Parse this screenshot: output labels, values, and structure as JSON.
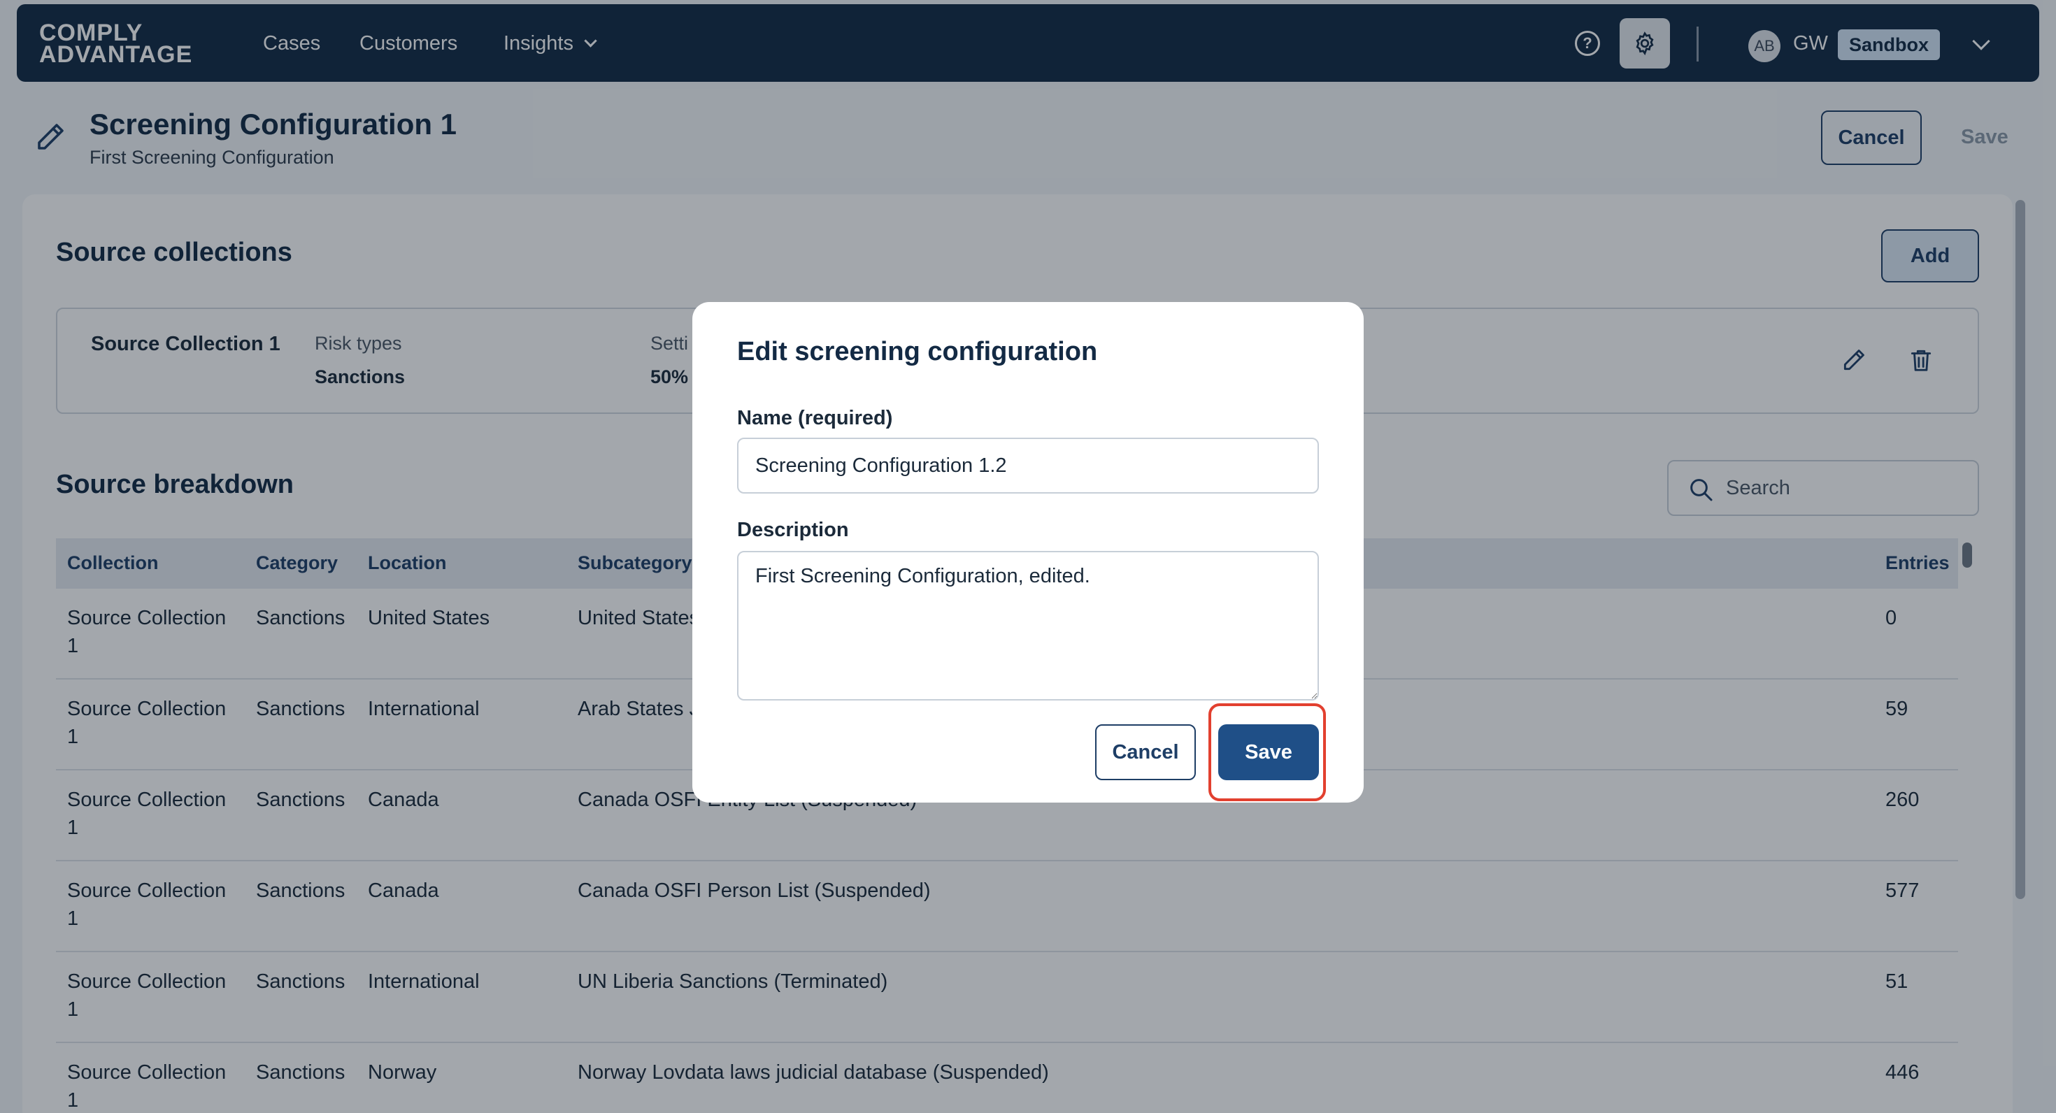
{
  "nav": {
    "logo_line1": "COMPLY",
    "logo_line2": "ADVANTAGE",
    "links": [
      "Cases",
      "Customers",
      "Insights"
    ],
    "help_glyph": "?",
    "avatar_initials": "AB",
    "user_initials": "GW",
    "environment": "Sandbox"
  },
  "header": {
    "title": "Screening Configuration 1",
    "subtitle": "First Screening Configuration",
    "cancel_label": "Cancel",
    "save_label": "Save"
  },
  "source_collections": {
    "title": "Source collections",
    "add_label": "Add",
    "item": {
      "name": "Source Collection 1",
      "risk_label": "Risk types",
      "risk_value": "Sanctions",
      "settings_label": "Setti",
      "settings_value": "50%"
    }
  },
  "source_breakdown": {
    "title": "Source breakdown",
    "search_placeholder": "Search",
    "columns": [
      "Collection",
      "Category",
      "Location",
      "Subcategory",
      "Entries"
    ],
    "rows": [
      {
        "collection": "Source Collection 1",
        "category": "Sanctions",
        "location": "United States",
        "subcategory": "United States",
        "entries": "0"
      },
      {
        "collection": "Source Collection 1",
        "category": "Sanctions",
        "location": "International",
        "subcategory": "Arab States J",
        "entries": "59"
      },
      {
        "collection": "Source Collection 1",
        "category": "Sanctions",
        "location": "Canada",
        "subcategory": "Canada OSFI Entity List (Suspended)",
        "entries": "260"
      },
      {
        "collection": "Source Collection 1",
        "category": "Sanctions",
        "location": "Canada",
        "subcategory": "Canada OSFI Person List (Suspended)",
        "entries": "577"
      },
      {
        "collection": "Source Collection 1",
        "category": "Sanctions",
        "location": "International",
        "subcategory": "UN Liberia Sanctions (Terminated)",
        "entries": "51"
      },
      {
        "collection": "Source Collection 1",
        "category": "Sanctions",
        "location": "Norway",
        "subcategory": "Norway Lovdata laws judicial database (Suspended)",
        "entries": "446"
      }
    ]
  },
  "modal": {
    "title": "Edit screening configuration",
    "name_label": "Name (required)",
    "name_value": "Screening Configuration 1.2",
    "description_label": "Description",
    "description_value": "First Screening Configuration, edited.",
    "cancel_label": "Cancel",
    "save_label": "Save"
  },
  "colors": {
    "nav_bg": "#132a44",
    "primary": "#1f4f87",
    "highlight": "#e2402f",
    "env_badge": "#d4e6f7"
  }
}
